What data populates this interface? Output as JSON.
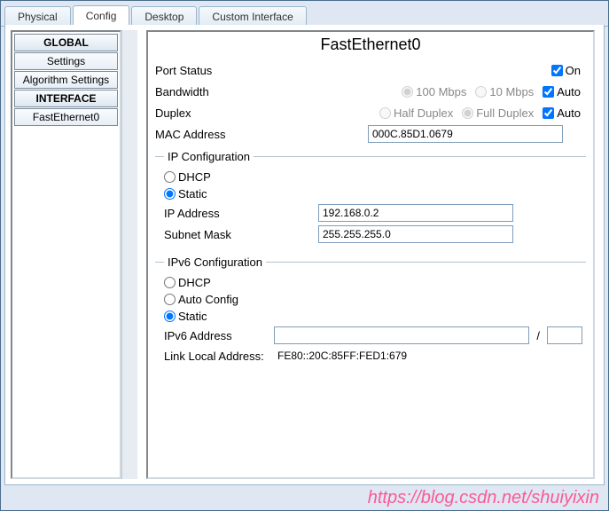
{
  "tabs": {
    "physical": "Physical",
    "config": "Config",
    "desktop": "Desktop",
    "custom": "Custom Interface"
  },
  "sidebar": {
    "global_header": "GLOBAL",
    "settings": "Settings",
    "algorithm_settings": "Algorithm Settings",
    "interface_header": "INTERFACE",
    "fe0": "FastEthernet0"
  },
  "panel": {
    "title": "FastEthernet0",
    "port_status_label": "Port Status",
    "on_label": "On",
    "bandwidth_label": "Bandwidth",
    "bw_100": "100 Mbps",
    "bw_10": "10 Mbps",
    "bw_auto": "Auto",
    "duplex_label": "Duplex",
    "dup_half": "Half Duplex",
    "dup_full": "Full Duplex",
    "dup_auto": "Auto",
    "mac_label": "MAC Address",
    "mac_value": "000C.85D1.0679"
  },
  "ipv4": {
    "legend": "IP Configuration",
    "dhcp": "DHCP",
    "static": "Static",
    "ip_label": "IP Address",
    "ip_value": "192.168.0.2",
    "mask_label": "Subnet Mask",
    "mask_value": "255.255.255.0"
  },
  "ipv6": {
    "legend": "IPv6 Configuration",
    "dhcp": "DHCP",
    "auto": "Auto Config",
    "static": "Static",
    "addr_label": "IPv6 Address",
    "addr_value": "",
    "prefix_sep": "/",
    "prefix_value": "",
    "linklocal_label": "Link Local Address:",
    "linklocal_value": "FE80::20C:85FF:FED1:679"
  },
  "watermark": "https://blog.csdn.net/shuiyixin"
}
